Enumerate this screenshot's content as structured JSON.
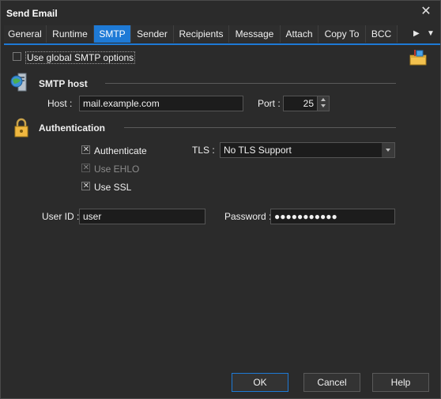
{
  "window": {
    "title": "Send Email",
    "close_glyph": "✕"
  },
  "tabs": {
    "items": [
      {
        "label": "General"
      },
      {
        "label": "Runtime"
      },
      {
        "label": "SMTP",
        "active": true
      },
      {
        "label": "Sender"
      },
      {
        "label": "Recipients"
      },
      {
        "label": "Message"
      },
      {
        "label": "Attach"
      },
      {
        "label": "Copy To"
      },
      {
        "label": "BCC"
      }
    ],
    "scroll_right_glyph": "▶",
    "menu_glyph": "▼"
  },
  "smtp": {
    "use_global": {
      "label": "Use global SMTP options",
      "checked": false
    },
    "host_section": {
      "title": "SMTP host",
      "icon": "server-globe-icon",
      "host_label": "Host :",
      "host_value": "mail.example.com",
      "port_label": "Port :",
      "port_value": "25"
    },
    "auth_section": {
      "title": "Authentication",
      "icon": "padlock-icon",
      "authenticate": {
        "label": "Authenticate",
        "checked": true
      },
      "use_ehlo": {
        "label": "Use EHLO",
        "checked": true,
        "disabled": true
      },
      "use_ssl": {
        "label": "Use SSL",
        "checked": true
      },
      "tls_label": "TLS :",
      "tls_value": "No TLS Support",
      "userid_label": "User ID :",
      "userid_value": "user",
      "password_label": "Password :",
      "password_value": "●●●●●●●●●●●"
    }
  },
  "buttons": {
    "ok": "OK",
    "cancel": "Cancel",
    "help": "Help"
  },
  "colors": {
    "accent": "#1e7ad6",
    "background": "#2b2b2b",
    "field": "#1c1c1c"
  }
}
